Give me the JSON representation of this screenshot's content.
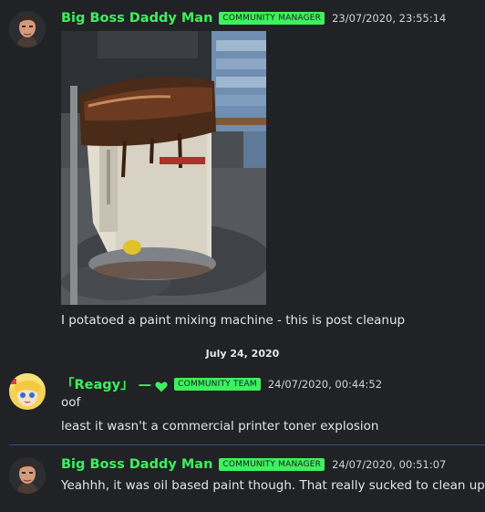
{
  "messages": [
    {
      "author": "Big Boss Daddy Man",
      "role": "COMMUNITY MANAGER",
      "timestamp": "23/07/2020, 23:55:14",
      "text": "I potatoed a paint mixing machine - this is post cleanup"
    },
    {
      "author": "「Reagy」 —",
      "role": "COMMUNITY TEAM",
      "timestamp": "24/07/2020, 00:44:52",
      "lines": [
        "oof",
        "least it wasn't a commercial printer toner explosion"
      ]
    },
    {
      "author": "Big Boss Daddy Man",
      "role": "COMMUNITY MANAGER",
      "timestamp": "24/07/2020, 00:51:07",
      "text": "Yeahhh, it was oil based paint though. That really sucked to clean up"
    }
  ],
  "date_divider": "July 24, 2020",
  "colors": {
    "username": "#3ef05e",
    "role_badge": "#3ef05e",
    "background": "#202225",
    "separator": "#3b4b8f"
  },
  "icons": {
    "reaction_in_name": "green-heart-icon"
  }
}
